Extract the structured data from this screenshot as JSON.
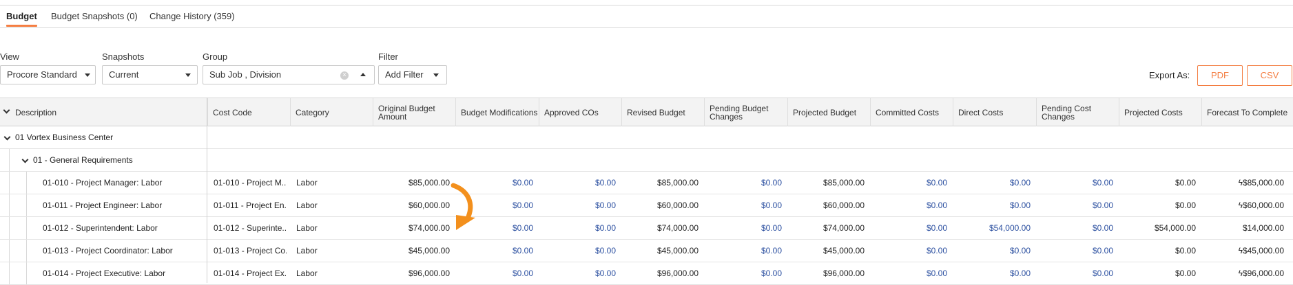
{
  "tabs": [
    {
      "label": "Budget",
      "active": true
    },
    {
      "label": "Budget Snapshots (0)",
      "active": false
    },
    {
      "label": "Change History (359)",
      "active": false
    }
  ],
  "controls": {
    "view": {
      "label": "View",
      "value": "Procore Standard"
    },
    "snapshots": {
      "label": "Snapshots",
      "value": "Current"
    },
    "group": {
      "label": "Group",
      "value": "Sub Job , Division"
    },
    "filter": {
      "label": "Filter",
      "value": "Add Filter"
    }
  },
  "export": {
    "label": "Export As:",
    "pdf": "PDF",
    "csv": "CSV",
    "accent_color": "#f47e42"
  },
  "table": {
    "columns": [
      "Description",
      "Cost Code",
      "Category",
      "Original Budget Amount",
      "Budget Modifications",
      "Approved COs",
      "Revised Budget",
      "Pending Budget Changes",
      "Projected Budget",
      "Committed Costs",
      "Direct Costs",
      "Pending Cost Changes",
      "Projected Costs",
      "Forecast To Complete"
    ],
    "groups": [
      {
        "label": "01 Vortex Business Center"
      },
      {
        "label": "01 - General Requirements"
      }
    ],
    "rows": [
      {
        "description": "01-010 - Project Manager: Labor",
        "cost_code": "01-010 - Project M...",
        "category": "Labor",
        "original_budget": "$85,000.00",
        "budget_mods": "$0.00",
        "approved_cos": "$0.00",
        "revised_budget": "$85,000.00",
        "pending_budget_changes": "$0.00",
        "projected_budget": "$85,000.00",
        "committed_costs": "$0.00",
        "direct_costs": "$0.00",
        "pending_cost_changes": "$0.00",
        "projected_costs": "$0.00",
        "forecast": "$85,000.00",
        "forecast_flag": "ϟ"
      },
      {
        "description": "01-011 - Project Engineer: Labor",
        "cost_code": "01-011 - Project En...",
        "category": "Labor",
        "original_budget": "$60,000.00",
        "budget_mods": "$0.00",
        "approved_cos": "$0.00",
        "revised_budget": "$60,000.00",
        "pending_budget_changes": "$0.00",
        "projected_budget": "$60,000.00",
        "committed_costs": "$0.00",
        "direct_costs": "$0.00",
        "pending_cost_changes": "$0.00",
        "projected_costs": "$0.00",
        "forecast": "$60,000.00",
        "forecast_flag": "ϟ"
      },
      {
        "description": "01-012 - Superintendent: Labor",
        "cost_code": "01-012 - Superinte...",
        "category": "Labor",
        "original_budget": "$74,000.00",
        "budget_mods": "$0.00",
        "approved_cos": "$0.00",
        "revised_budget": "$74,000.00",
        "pending_budget_changes": "$0.00",
        "projected_budget": "$74,000.00",
        "committed_costs": "$0.00",
        "direct_costs": "$54,000.00",
        "pending_cost_changes": "$0.00",
        "projected_costs": "$54,000.00",
        "forecast": "$14,000.00",
        "forecast_flag": ""
      },
      {
        "description": "01-013 - Project Coordinator: Labor",
        "cost_code": "01-013 - Project Co...",
        "category": "Labor",
        "original_budget": "$45,000.00",
        "budget_mods": "$0.00",
        "approved_cos": "$0.00",
        "revised_budget": "$45,000.00",
        "pending_budget_changes": "$0.00",
        "projected_budget": "$45,000.00",
        "committed_costs": "$0.00",
        "direct_costs": "$0.00",
        "pending_cost_changes": "$0.00",
        "projected_costs": "$0.00",
        "forecast": "$45,000.00",
        "forecast_flag": "ϟ"
      },
      {
        "description": "01-014 - Project Executive: Labor",
        "cost_code": "01-014 - Project Ex...",
        "category": "Labor",
        "original_budget": "$96,000.00",
        "budget_mods": "$0.00",
        "approved_cos": "$0.00",
        "revised_budget": "$96,000.00",
        "pending_budget_changes": "$0.00",
        "projected_budget": "$96,000.00",
        "committed_costs": "$0.00",
        "direct_costs": "$0.00",
        "pending_cost_changes": "$0.00",
        "projected_costs": "$0.00",
        "forecast": "$96,000.00",
        "forecast_flag": "ϟ"
      }
    ]
  },
  "colors": {
    "link": "#2b4fa0",
    "accent": "#f47e42",
    "header_bg": "#f3f3f3"
  }
}
